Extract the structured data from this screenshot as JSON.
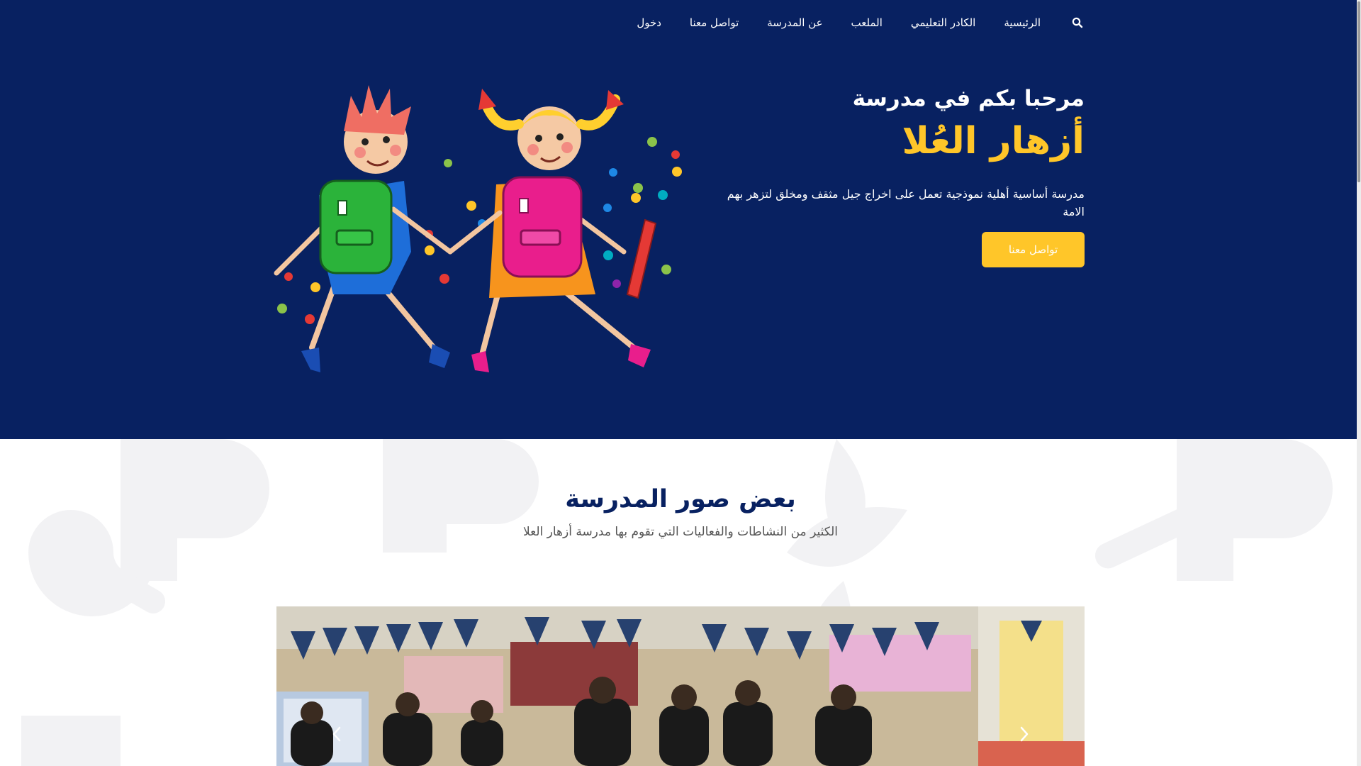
{
  "nav": {
    "search_icon": "search-icon",
    "items": [
      "الرئيسية",
      "الكادر التعليمي",
      "الملعب",
      "عن المدرسة",
      "تواصل معنا",
      "دخول"
    ]
  },
  "hero": {
    "welcome": "مرحبا بكم في مدرسة",
    "school_name": "أزهار العُلا",
    "description": "مدرسة أساسية أهلية نموذجية تعمل على اخراج جيل مثقف ومخلق لتزهر بهم الامة",
    "cta_label": "تواصل معنا"
  },
  "gallery_section": {
    "title": "بعض صور المدرسة",
    "subtitle": "الكثير من النشاطات والفعاليات التي تقوم بها مدرسة أزهار العلا",
    "prev_icon": "chevron-left-icon",
    "next_icon": "chevron-right-icon"
  },
  "colors": {
    "navy": "#082161",
    "yellow": "#ffc629",
    "white": "#ffffff"
  }
}
